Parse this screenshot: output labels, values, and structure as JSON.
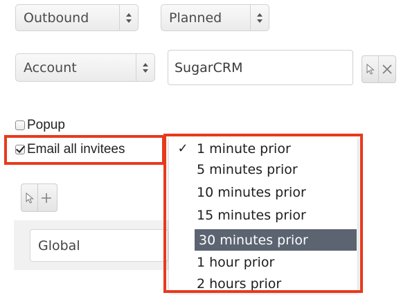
{
  "direction_select": {
    "value": "Outbound"
  },
  "status_select": {
    "value": "Planned"
  },
  "parent_type_select": {
    "value": "Account"
  },
  "parent_name_input": {
    "value": "SugarCRM"
  },
  "popup_checkbox": {
    "label": "Popup",
    "checked": false
  },
  "email_invitees_checkbox": {
    "label": "Email all invitees",
    "checked": true
  },
  "team_field": {
    "value": "Global"
  },
  "reminder_dropdown": {
    "options": [
      {
        "label": "1 minute prior",
        "checked": true
      },
      {
        "label": "5 minutes prior",
        "checked": false
      },
      {
        "label": "10 minutes prior",
        "checked": false
      },
      {
        "label": "15 minutes prior",
        "checked": false
      },
      {
        "label": "30 minutes prior",
        "checked": false,
        "highlighted": true
      },
      {
        "label": "1 hour prior",
        "checked": false
      },
      {
        "label": "2 hours prior",
        "checked": false
      }
    ],
    "check_glyph": "✓"
  },
  "icons": {
    "select_arrows": "updown-arrows-icon",
    "select_cursor": "cursor-arrow-icon",
    "clear": "close-icon",
    "add": "plus-icon"
  },
  "colors": {
    "highlight": "#e8391c",
    "hover_bg": "#5c6471"
  }
}
